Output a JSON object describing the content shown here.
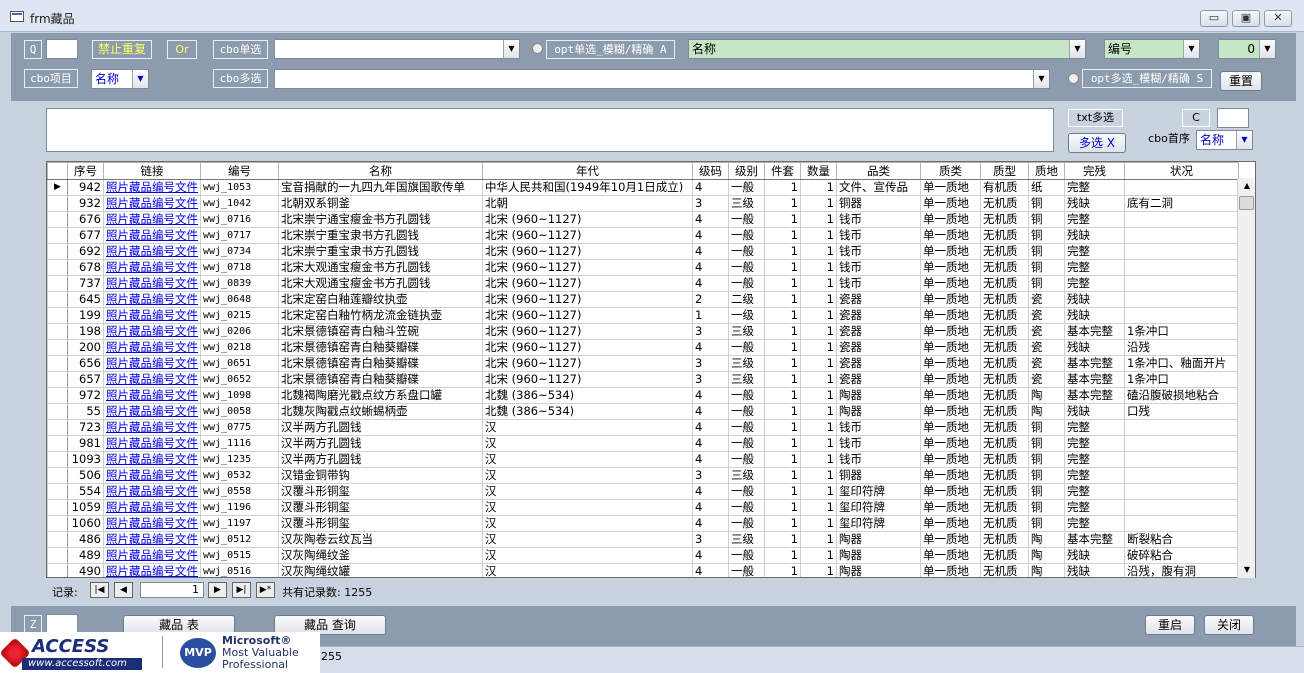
{
  "window": {
    "title": "frm藏品",
    "minimize": "▭",
    "restore": "▣",
    "close": "✕"
  },
  "header": {
    "q_label": "Q",
    "no_repeat_label": "禁止重复",
    "or_label": "Or",
    "cbo_single_label": "cbo单选",
    "opt_single_label": "opt单选_模糊/精确 A",
    "field_combo_value": "名称",
    "num_combo_value": "编号",
    "zero_combo_value": "0",
    "cbo_item_label": "cbo项目",
    "cbo_item_value": "名称",
    "cbo_multi_label": "cbo多选",
    "opt_multi_label": "opt多选_模糊/精确 S",
    "reset_button": "重置"
  },
  "center": {
    "txt_multi_label": "txt多选",
    "c_label": "C",
    "multi_button": "多选 X",
    "cbo_first_label": "cbo首序",
    "cbo_first_value": "名称"
  },
  "grid": {
    "columns": [
      "序号",
      "链接",
      "编号",
      "名称",
      "年代",
      "级码",
      "级别",
      "件套",
      "数量",
      "品类",
      "质类",
      "质型",
      "质地",
      "完残",
      "状况"
    ],
    "rows": [
      [
        "942",
        "照片藏品编号文件",
        "wwj_1053",
        "宝音捐献的一九四九年国旗国歌传单",
        "中华人民共和国(1949年10月1日成立)",
        "4",
        "一般",
        "1",
        "1",
        "文件、宣传品",
        "单一质地",
        "有机质",
        "纸",
        "完整",
        ""
      ],
      [
        "932",
        "照片藏品编号文件",
        "wwj_1042",
        "北朝双系铜釜",
        "北朝",
        "3",
        "三级",
        "1",
        "1",
        "铜器",
        "单一质地",
        "无机质",
        "铜",
        "残缺",
        "底有二洞"
      ],
      [
        "676",
        "照片藏品编号文件",
        "wwj_0716",
        "北宋崇宁通宝瘦金书方孔圆钱",
        "北宋 (960~1127)",
        "4",
        "一般",
        "1",
        "1",
        "钱币",
        "单一质地",
        "无机质",
        "铜",
        "完整",
        ""
      ],
      [
        "677",
        "照片藏品编号文件",
        "wwj_0717",
        "北宋崇宁重宝隶书方孔圆钱",
        "北宋 (960~1127)",
        "4",
        "一般",
        "1",
        "1",
        "钱币",
        "单一质地",
        "无机质",
        "铜",
        "残缺",
        ""
      ],
      [
        "692",
        "照片藏品编号文件",
        "wwj_0734",
        "北宋崇宁重宝隶书方孔圆钱",
        "北宋 (960~1127)",
        "4",
        "一般",
        "1",
        "1",
        "钱币",
        "单一质地",
        "无机质",
        "铜",
        "完整",
        ""
      ],
      [
        "678",
        "照片藏品编号文件",
        "wwj_0718",
        "北宋大观通宝瘦金书方孔圆钱",
        "北宋 (960~1127)",
        "4",
        "一般",
        "1",
        "1",
        "钱币",
        "单一质地",
        "无机质",
        "铜",
        "完整",
        ""
      ],
      [
        "737",
        "照片藏品编号文件",
        "wwj_0839",
        "北宋大观通宝瘦金书方孔圆钱",
        "北宋 (960~1127)",
        "4",
        "一般",
        "1",
        "1",
        "钱币",
        "单一质地",
        "无机质",
        "铜",
        "完整",
        ""
      ],
      [
        "645",
        "照片藏品编号文件",
        "wwj_0648",
        "北宋定窑白釉莲瓣纹执壶",
        "北宋 (960~1127)",
        "2",
        "二级",
        "1",
        "1",
        "瓷器",
        "单一质地",
        "无机质",
        "瓷",
        "残缺",
        ""
      ],
      [
        "199",
        "照片藏品编号文件",
        "wwj_0215",
        "北宋定窑白釉竹柄龙流金链执壶",
        "北宋 (960~1127)",
        "1",
        "一级",
        "1",
        "1",
        "瓷器",
        "单一质地",
        "无机质",
        "瓷",
        "残缺",
        ""
      ],
      [
        "198",
        "照片藏品编号文件",
        "wwj_0206",
        "北宋景德镇窑青白釉斗笠碗",
        "北宋 (960~1127)",
        "3",
        "三级",
        "1",
        "1",
        "瓷器",
        "单一质地",
        "无机质",
        "瓷",
        "基本完整",
        "1条冲口"
      ],
      [
        "200",
        "照片藏品编号文件",
        "wwj_0218",
        "北宋景德镇窑青白釉葵瓣碟",
        "北宋 (960~1127)",
        "4",
        "一般",
        "1",
        "1",
        "瓷器",
        "单一质地",
        "无机质",
        "瓷",
        "残缺",
        "沿残"
      ],
      [
        "656",
        "照片藏品编号文件",
        "wwj_0651",
        "北宋景德镇窑青白釉葵瓣碟",
        "北宋 (960~1127)",
        "3",
        "三级",
        "1",
        "1",
        "瓷器",
        "单一质地",
        "无机质",
        "瓷",
        "基本完整",
        "1条冲口、釉面开片"
      ],
      [
        "657",
        "照片藏品编号文件",
        "wwj_0652",
        "北宋景德镇窑青白釉葵瓣碟",
        "北宋 (960~1127)",
        "3",
        "三级",
        "1",
        "1",
        "瓷器",
        "单一质地",
        "无机质",
        "瓷",
        "基本完整",
        "1条冲口"
      ],
      [
        "972",
        "照片藏品编号文件",
        "wwj_1098",
        "北魏褐陶磨光戳点纹方系盘口罐",
        "北魏 (386~534)",
        "4",
        "一般",
        "1",
        "1",
        "陶器",
        "单一质地",
        "无机质",
        "陶",
        "基本完整",
        "磕沿腹破损地粘合"
      ],
      [
        "55",
        "照片藏品编号文件",
        "wwj_0058",
        "北魏灰陶戳点纹蜥蜴柄壶",
        "北魏 (386~534)",
        "4",
        "一般",
        "1",
        "1",
        "陶器",
        "单一质地",
        "无机质",
        "陶",
        "残缺",
        "口残"
      ],
      [
        "723",
        "照片藏品编号文件",
        "wwj_0775",
        "汉半两方孔圆钱",
        "汉",
        "4",
        "一般",
        "1",
        "1",
        "钱币",
        "单一质地",
        "无机质",
        "铜",
        "完整",
        ""
      ],
      [
        "981",
        "照片藏品编号文件",
        "wwj_1116",
        "汉半两方孔圆钱",
        "汉",
        "4",
        "一般",
        "1",
        "1",
        "钱币",
        "单一质地",
        "无机质",
        "铜",
        "完整",
        ""
      ],
      [
        "1093",
        "照片藏品编号文件",
        "wwj_1235",
        "汉半两方孔圆钱",
        "汉",
        "4",
        "一般",
        "1",
        "1",
        "钱币",
        "单一质地",
        "无机质",
        "铜",
        "完整",
        ""
      ],
      [
        "506",
        "照片藏品编号文件",
        "wwj_0532",
        "汉错金铜带钩",
        "汉",
        "3",
        "三级",
        "1",
        "1",
        "铜器",
        "单一质地",
        "无机质",
        "铜",
        "完整",
        ""
      ],
      [
        "554",
        "照片藏品编号文件",
        "wwj_0558",
        "汉覆斗形铜玺",
        "汉",
        "4",
        "一般",
        "1",
        "1",
        "玺印符牌",
        "单一质地",
        "无机质",
        "铜",
        "完整",
        ""
      ],
      [
        "1059",
        "照片藏品编号文件",
        "wwj_1196",
        "汉覆斗形铜玺",
        "汉",
        "4",
        "一般",
        "1",
        "1",
        "玺印符牌",
        "单一质地",
        "无机质",
        "铜",
        "完整",
        ""
      ],
      [
        "1060",
        "照片藏品编号文件",
        "wwj_1197",
        "汉覆斗形铜玺",
        "汉",
        "4",
        "一般",
        "1",
        "1",
        "玺印符牌",
        "单一质地",
        "无机质",
        "铜",
        "完整",
        ""
      ],
      [
        "486",
        "照片藏品编号文件",
        "wwj_0512",
        "汉灰陶卷云纹瓦当",
        "汉",
        "3",
        "三级",
        "1",
        "1",
        "陶器",
        "单一质地",
        "无机质",
        "陶",
        "基本完整",
        "断裂粘合"
      ],
      [
        "489",
        "照片藏品编号文件",
        "wwj_0515",
        "汉灰陶绳纹釜",
        "汉",
        "4",
        "一般",
        "1",
        "1",
        "陶器",
        "单一质地",
        "无机质",
        "陶",
        "残缺",
        "破碎粘合"
      ],
      [
        "490",
        "照片藏品编号文件",
        "wwj_0516",
        "汉灰陶绳纹罐",
        "汉",
        "4",
        "一般",
        "1",
        "1",
        "陶器",
        "单一质地",
        "无机质",
        "陶",
        "残缺",
        "沿残，腹有洞"
      ]
    ]
  },
  "nav": {
    "record_label": "记录:",
    "current": "1",
    "total_text": "共有记录数: 1255"
  },
  "footer": {
    "z_label": "Z",
    "table_button": "藏品 表",
    "query_button": "藏品 查询",
    "restart_button": "重启",
    "close_button": "关闭"
  },
  "status": {
    "count": "1255"
  },
  "logo": {
    "access_text": "ACCESS",
    "access_url": "www.accessoft.com",
    "mvp_badge": "MVP",
    "ms_line1": "Microsoft®",
    "ms_line2": "Most Valuable",
    "ms_line3": "Professional"
  }
}
